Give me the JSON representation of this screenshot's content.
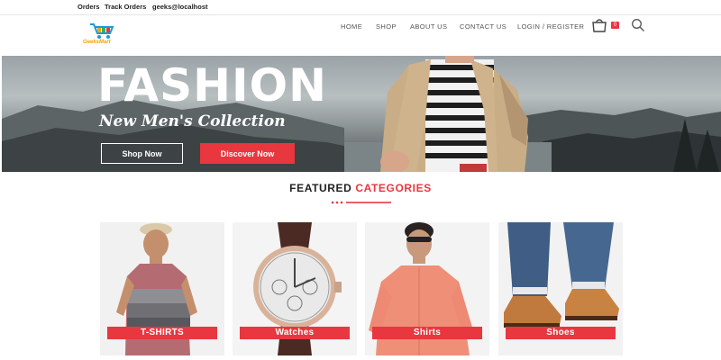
{
  "topbar": {
    "orders": "Orders",
    "track_orders": "Track Orders",
    "user": "geeks@localhost"
  },
  "brand": {
    "name": "GeeksMart"
  },
  "nav": {
    "home": "HOME",
    "shop": "SHOP",
    "about": "ABOUT US",
    "contact": "CONTACT US",
    "login": "LOGIN / REGISTER"
  },
  "cart": {
    "count": "0"
  },
  "hero": {
    "title": "FASHION",
    "subtitle": "New Men's Collection",
    "shop_now": "Shop Now",
    "discover_now": "Discover Now"
  },
  "featured": {
    "prefix": "FEATURED",
    "highlight": "CATEGORIES"
  },
  "categories": [
    {
      "label": "T-SHIRTS"
    },
    {
      "label": "Watches"
    },
    {
      "label": "Shirts"
    },
    {
      "label": "Shoes"
    }
  ],
  "colors": {
    "accent": "#e8373f",
    "brand": "#f2a400"
  }
}
